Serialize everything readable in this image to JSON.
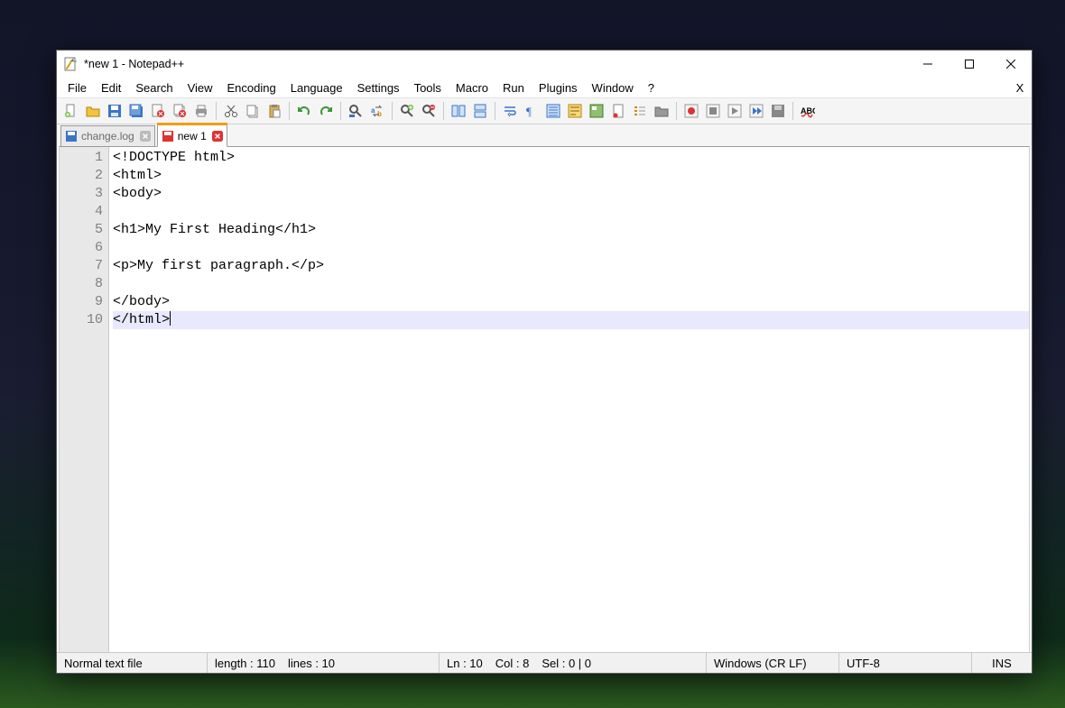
{
  "title": "*new 1 - Notepad++",
  "menus": [
    "File",
    "Edit",
    "Search",
    "View",
    "Encoding",
    "Language",
    "Settings",
    "Tools",
    "Macro",
    "Run",
    "Plugins",
    "Window",
    "?"
  ],
  "toolbar_icons": [
    "new-file-icon",
    "open-file-icon",
    "save-icon",
    "save-all-icon",
    "close-icon",
    "close-all-icon",
    "print-icon",
    "sep",
    "cut-icon",
    "copy-icon",
    "paste-icon",
    "sep",
    "undo-icon",
    "redo-icon",
    "sep",
    "find-icon",
    "replace-icon",
    "sep",
    "zoom-in-icon",
    "zoom-out-icon",
    "sep",
    "sync-v-icon",
    "sync-h-icon",
    "sep",
    "word-wrap-icon",
    "all-chars-icon",
    "indent-guide-icon",
    "udl-icon",
    "doc-map-icon",
    "doc-list-icon",
    "func-list-icon",
    "folder-icon",
    "sep",
    "record-macro-icon",
    "stop-macro-icon",
    "play-macro-icon",
    "play-multi-icon",
    "save-macro-icon",
    "sep",
    "spell-check-icon"
  ],
  "tabs": [
    {
      "label": "change.log",
      "modified": false,
      "active": false
    },
    {
      "label": "new 1",
      "modified": true,
      "active": true
    }
  ],
  "editor": {
    "lines": [
      "<!DOCTYPE html>",
      "<html>",
      "<body>",
      "",
      "<h1>My First Heading</h1>",
      "",
      "<p>My first paragraph.</p>",
      "",
      "</body>",
      "</html>"
    ],
    "current_line": 10
  },
  "status": {
    "filetype": "Normal text file",
    "length_label": "length : 110",
    "lines_label": "lines : 10",
    "ln_label": "Ln : 10",
    "col_label": "Col : 8",
    "sel_label": "Sel : 0 | 0",
    "eol": "Windows (CR LF)",
    "encoding": "UTF-8",
    "ins": "INS"
  }
}
